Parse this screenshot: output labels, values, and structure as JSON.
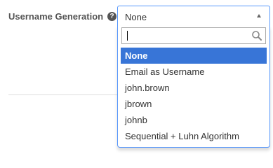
{
  "field": {
    "label": "Username Generation",
    "help_glyph": "?"
  },
  "select": {
    "value": "None"
  },
  "search": {
    "value": "",
    "placeholder": ""
  },
  "options": [
    "None",
    "Email as Username",
    "john.brown",
    "jbrown",
    "johnb",
    "Sequential + Luhn Algorithm"
  ],
  "highlighted_option": "None",
  "colors": {
    "highlight": "#3875d7",
    "focus_border": "#5897fb",
    "label_text": "#555555"
  },
  "icons": [
    "help-icon",
    "caret-up-icon",
    "search-icon"
  ]
}
